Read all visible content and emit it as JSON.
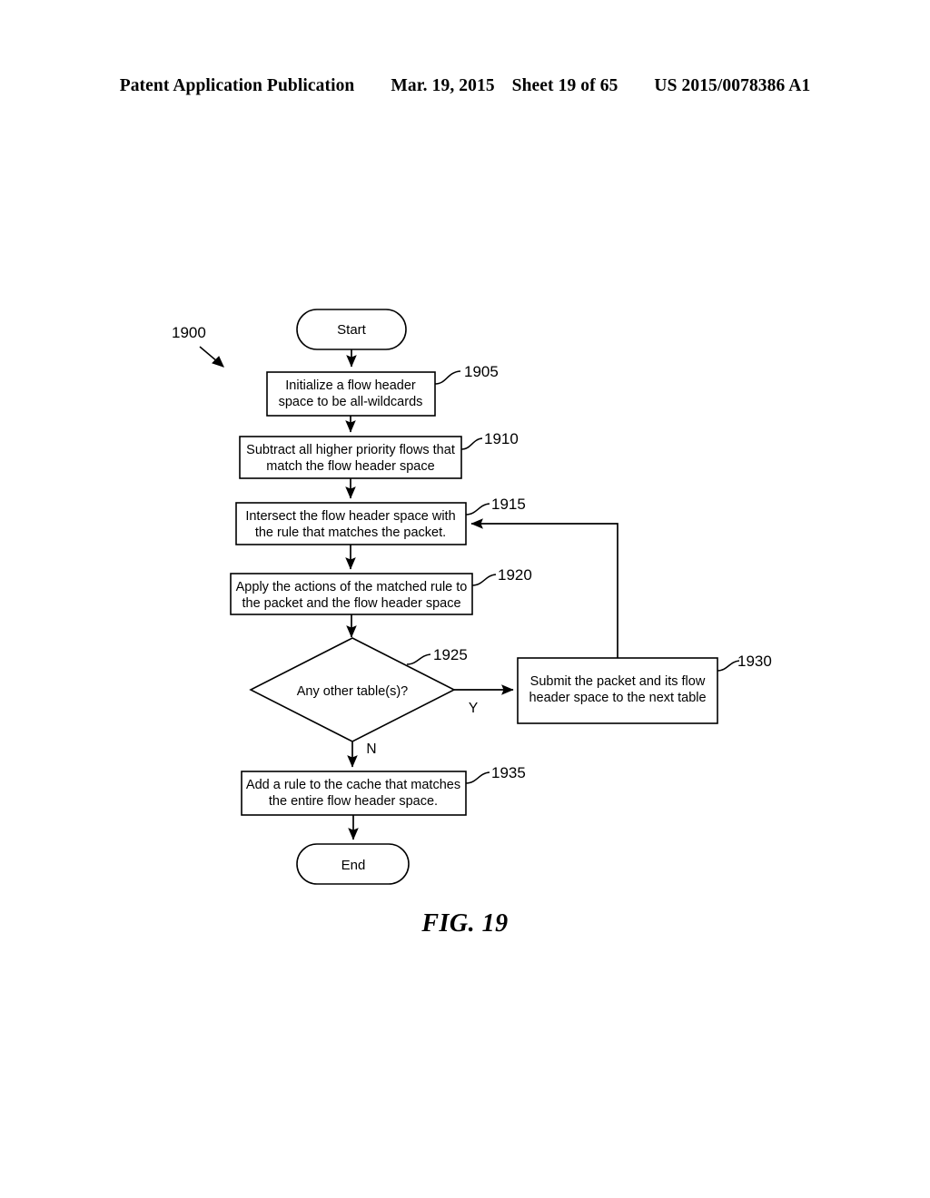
{
  "header": {
    "publication": "Patent Application Publication",
    "date": "Mar. 19, 2015",
    "sheet": "Sheet 19 of 65",
    "doc_number": "US 2015/0078386 A1"
  },
  "figure": {
    "caption": "FIG. 19",
    "diagram_ref": "1900",
    "terminals": {
      "start": "Start",
      "end": "End"
    },
    "branch_labels": {
      "yes": "Y",
      "no": "N"
    },
    "steps": [
      {
        "ref": "1905",
        "text_lines": [
          "Initialize a flow header",
          "space to be all-wildcards"
        ],
        "shape": "process"
      },
      {
        "ref": "1910",
        "text_lines": [
          "Subtract all higher priority flows that",
          "match the flow header space"
        ],
        "shape": "process"
      },
      {
        "ref": "1915",
        "text_lines": [
          "Intersect the flow header space with",
          "the rule that matches the packet."
        ],
        "shape": "process"
      },
      {
        "ref": "1920",
        "text_lines": [
          "Apply the actions of the matched rule to",
          "the packet and the flow header space"
        ],
        "shape": "process"
      },
      {
        "ref": "1925",
        "text_lines": [
          "Any other table(s)?"
        ],
        "shape": "decision"
      },
      {
        "ref": "1930",
        "text_lines": [
          "Submit the packet and its flow",
          "header space to the next table"
        ],
        "shape": "process"
      },
      {
        "ref": "1935",
        "text_lines": [
          "Add a rule to the cache that matches",
          "the entire flow header space."
        ],
        "shape": "process"
      }
    ]
  },
  "chart_data": {
    "type": "diagram",
    "title": "FIG. 19",
    "nodes": [
      {
        "id": "start",
        "label": "Start",
        "type": "terminator"
      },
      {
        "id": "1905",
        "label": "Initialize a flow header space to be all-wildcards",
        "type": "process"
      },
      {
        "id": "1910",
        "label": "Subtract all higher priority flows that match the flow header space",
        "type": "process"
      },
      {
        "id": "1915",
        "label": "Intersect the flow header space with the rule that matches the packet.",
        "type": "process"
      },
      {
        "id": "1920",
        "label": "Apply the actions of the matched rule to the packet and the flow header space",
        "type": "process"
      },
      {
        "id": "1925",
        "label": "Any other table(s)?",
        "type": "decision"
      },
      {
        "id": "1930",
        "label": "Submit the packet and its flow header space to the next table",
        "type": "process"
      },
      {
        "id": "1935",
        "label": "Add a rule to the cache that matches the entire flow header space.",
        "type": "process"
      },
      {
        "id": "end",
        "label": "End",
        "type": "terminator"
      }
    ],
    "edges": [
      {
        "from": "start",
        "to": "1905",
        "label": ""
      },
      {
        "from": "1905",
        "to": "1910",
        "label": ""
      },
      {
        "from": "1910",
        "to": "1915",
        "label": ""
      },
      {
        "from": "1915",
        "to": "1920",
        "label": ""
      },
      {
        "from": "1920",
        "to": "1925",
        "label": ""
      },
      {
        "from": "1925",
        "to": "1930",
        "label": "Y"
      },
      {
        "from": "1925",
        "to": "1935",
        "label": "N"
      },
      {
        "from": "1930",
        "to": "1915",
        "label": ""
      },
      {
        "from": "1935",
        "to": "end",
        "label": ""
      }
    ]
  }
}
